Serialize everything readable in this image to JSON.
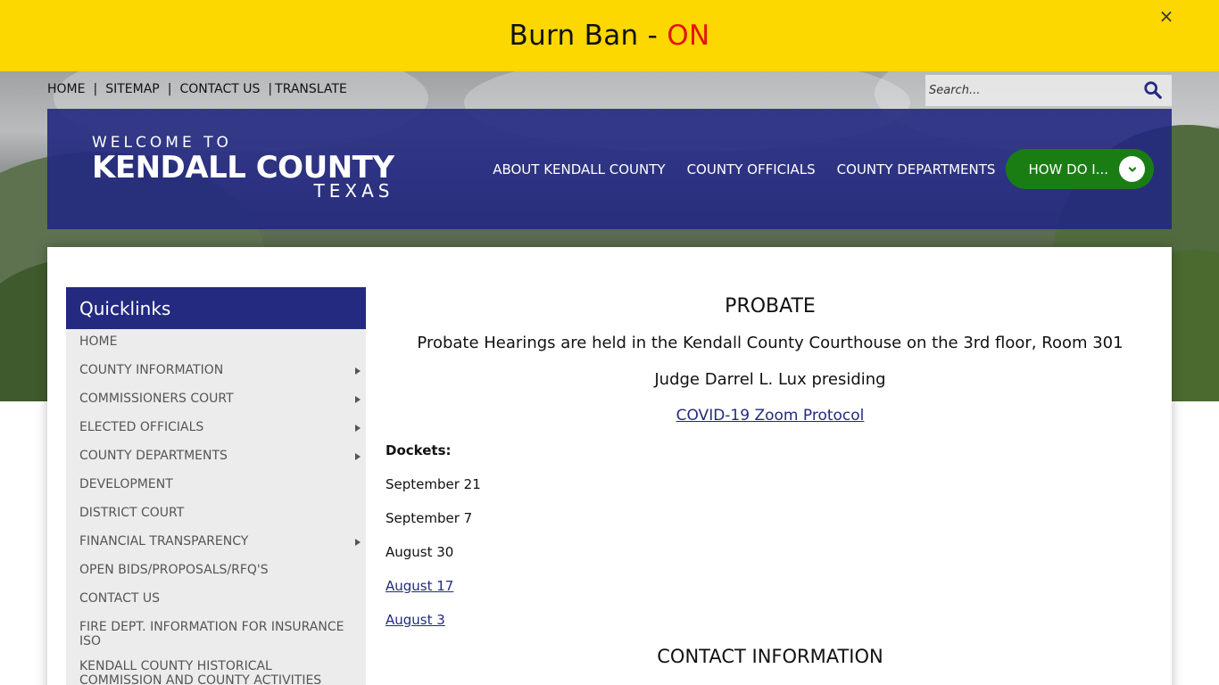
{
  "banner": {
    "prefix": "Burn Ban - ",
    "status": "ON",
    "close_glyph": "×"
  },
  "util_nav": {
    "items": [
      "HOME",
      "SITEMAP",
      "CONTACT US",
      "TRANSLATE"
    ],
    "separator": "|"
  },
  "search": {
    "placeholder": "Search..."
  },
  "logo": {
    "welcome": "WELCOME TO",
    "county": "KENDALL COUNTY",
    "state": "TEXAS"
  },
  "main_nav": {
    "items": [
      "ABOUT KENDALL COUNTY",
      "COUNTY OFFICIALS",
      "COUNTY DEPARTMENTS"
    ],
    "how_do_i": "HOW DO I..."
  },
  "sidebar": {
    "title": "Quicklinks",
    "items": [
      {
        "label": "HOME",
        "has_children": false
      },
      {
        "label": "COUNTY INFORMATION",
        "has_children": true
      },
      {
        "label": "COMMISSIONERS COURT",
        "has_children": true
      },
      {
        "label": "ELECTED OFFICIALS",
        "has_children": true
      },
      {
        "label": "COUNTY DEPARTMENTS",
        "has_children": true
      },
      {
        "label": "DEVELOPMENT",
        "has_children": false
      },
      {
        "label": "DISTRICT COURT",
        "has_children": false
      },
      {
        "label": "FINANCIAL TRANSPARENCY",
        "has_children": true
      },
      {
        "label": "OPEN BIDS/PROPOSALS/RFQ'S",
        "has_children": false
      },
      {
        "label": "CONTACT US",
        "has_children": false
      },
      {
        "label": "FIRE DEPT. INFORMATION FOR INSURANCE ISO",
        "has_children": false
      },
      {
        "label": "KENDALL COUNTY HISTORICAL COMMISSION AND COUNTY ACTIVITIES",
        "has_children": false
      }
    ]
  },
  "article": {
    "title": "PROBATE",
    "line1": "Probate Hearings are held in the Kendall County Courthouse on the 3rd floor, Room 301",
    "line2": "Judge Darrel L. Lux presiding",
    "zoom_link": "COVID-19 Zoom Protocol",
    "dockets_label": "Dockets:",
    "dockets": [
      {
        "label": "September 21",
        "link": false
      },
      {
        "label": "September 7",
        "link": false
      },
      {
        "label": "August 30",
        "link": false
      },
      {
        "label": "August 17",
        "link": true
      },
      {
        "label": "August 3",
        "link": true
      }
    ],
    "contact_heading": "CONTACT INFORMATION"
  },
  "colors": {
    "banner_bg": "#fdd700",
    "status_on": "#e3140f",
    "header_blue": "#232a80",
    "how_do_i_green": "#1a7d14",
    "sidebar_bg": "#ececec"
  }
}
